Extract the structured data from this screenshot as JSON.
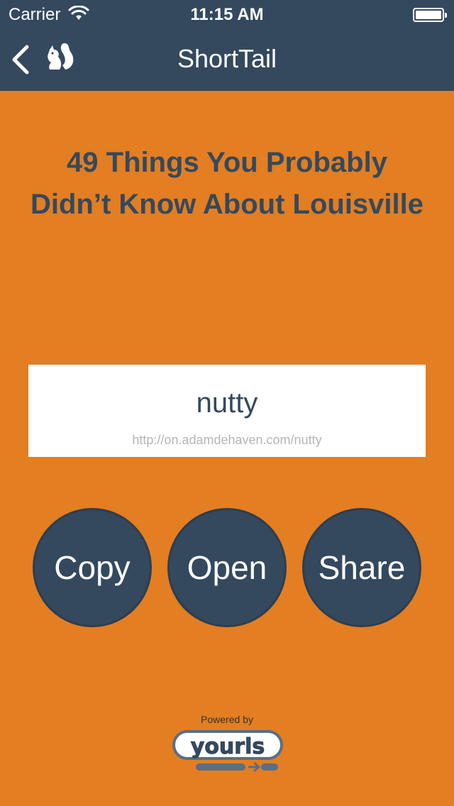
{
  "status_bar": {
    "carrier": "Carrier",
    "time": "11:15 AM"
  },
  "nav": {
    "title": "ShortTail",
    "back_icon": "chevron-left-icon",
    "logo_icon": "squirrel-icon"
  },
  "article": {
    "title": "49 Things You Probably Didn’t Know About Louisville"
  },
  "short_link": {
    "keyword": "nutty",
    "url": "http://on.adamdehaven.com/nutty"
  },
  "actions": {
    "copy_label": "Copy",
    "open_label": "Open",
    "share_label": "Share"
  },
  "footer": {
    "powered_by": "Powered by",
    "logo_text": "yourls"
  },
  "colors": {
    "background": "#e37e22",
    "nav": "#34495e",
    "button": "#34495e",
    "card": "#ffffff"
  }
}
